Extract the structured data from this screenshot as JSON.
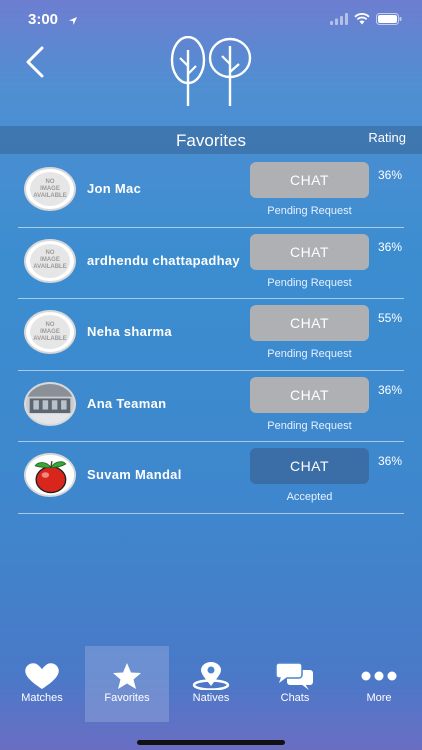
{
  "status_bar": {
    "time": "3:00"
  },
  "header": {
    "back_icon": "chevron-left-icon",
    "logo_icon": "trees-logo-icon"
  },
  "section": {
    "title": "Favorites",
    "rating_label": "Rating"
  },
  "favorites": [
    {
      "name": "Jon Mac",
      "avatar": "no-image",
      "chat_label": "CHAT",
      "status": "Pending Request",
      "rating": "36%"
    },
    {
      "name": "ardhendu chattapadhay",
      "avatar": "no-image",
      "chat_label": "CHAT",
      "status": "Pending Request",
      "rating": "36%"
    },
    {
      "name": "Neha sharma",
      "avatar": "no-image",
      "chat_label": "CHAT",
      "status": "Pending Request",
      "rating": "55%"
    },
    {
      "name": "Ana Teaman",
      "avatar": "photo-building",
      "chat_label": "CHAT",
      "status": "Pending Request",
      "rating": "36%"
    },
    {
      "name": "Suvam Mandal",
      "avatar": "photo-apple",
      "chat_label": "CHAT",
      "status": "Accepted",
      "rating": "36%"
    }
  ],
  "no_image_text": [
    "NO",
    "IMAGE",
    "AVAILABLE"
  ],
  "tabs": [
    {
      "label": "Matches",
      "icon": "heart-icon",
      "active": false
    },
    {
      "label": "Favorites",
      "icon": "star-icon",
      "active": true
    },
    {
      "label": "Natives",
      "icon": "location-pin-icon",
      "active": false
    },
    {
      "label": "Chats",
      "icon": "chat-bubbles-icon",
      "active": false
    },
    {
      "label": "More",
      "icon": "more-dots-icon",
      "active": false
    }
  ],
  "colors": {
    "accent_accepted": "#3b6ea7",
    "button_pending": "#aeb0b3"
  }
}
